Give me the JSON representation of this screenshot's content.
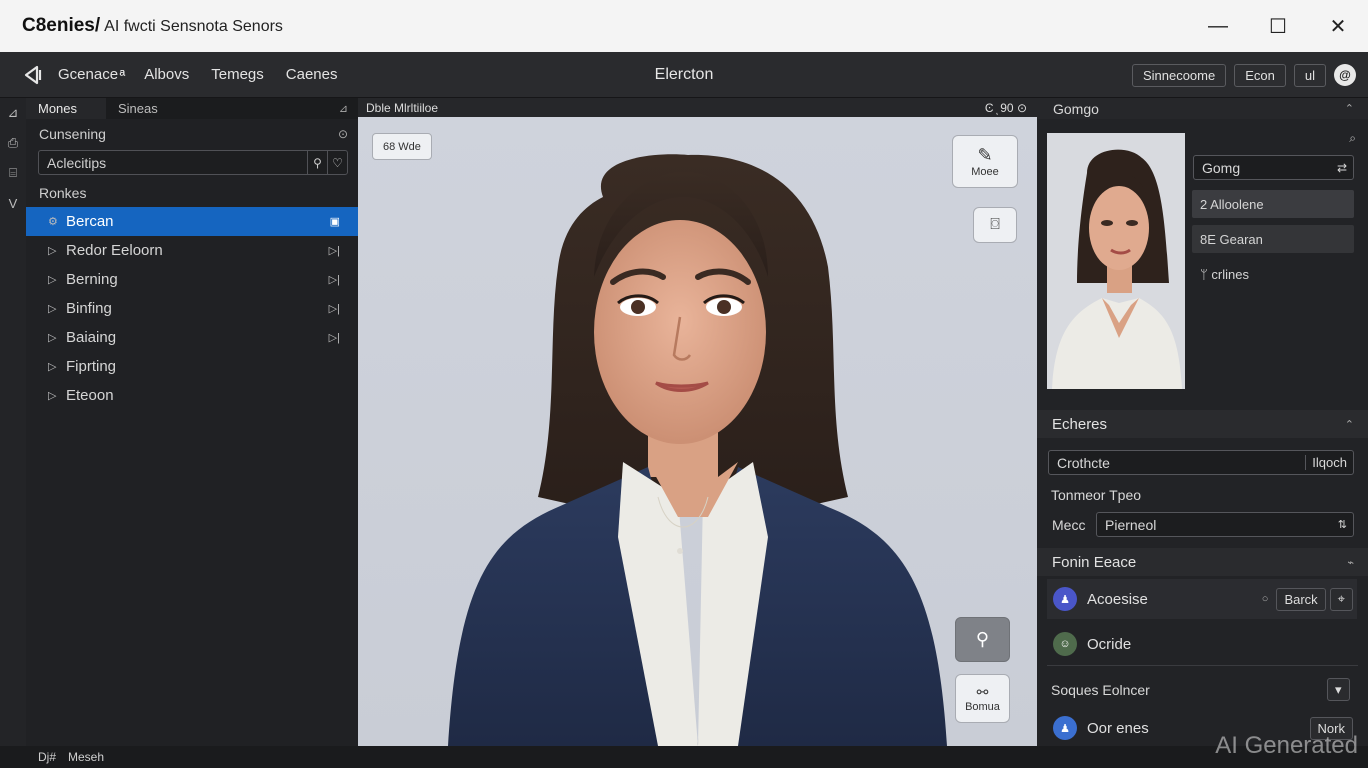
{
  "window": {
    "title_brand": "C8enies/",
    "title_rest": "AI fwcti Sensnota Senors",
    "minimize_glyph": "—",
    "maximize_glyph": "☐",
    "close_glyph": "✕"
  },
  "menubar": {
    "items": [
      "Gcenace ͣͣͣ",
      "Albovs",
      "Temegs",
      "Caenes"
    ],
    "center_title": "Elercton",
    "right_buttons": [
      "Sinnecoome",
      "Econ",
      "ul"
    ],
    "profile_glyph": "@"
  },
  "rail": {
    "icons": [
      "⊿",
      "⎙",
      "⌸",
      "V"
    ]
  },
  "left_panel": {
    "tabs": [
      "Mones",
      "Sineas"
    ],
    "section_title": "Cunsening",
    "search_value": "Aclecitips",
    "tree_header": "Ronkes",
    "tree_items": [
      {
        "label": "Bercan",
        "selected": true
      },
      {
        "label": "Redor Eeloorn",
        "selected": false
      },
      {
        "label": "Berning",
        "selected": false
      },
      {
        "label": "Binfing",
        "selected": false
      },
      {
        "label": "Baiaing",
        "selected": false
      },
      {
        "label": "Fiprting",
        "selected": false
      },
      {
        "label": "Eteoon",
        "selected": false
      }
    ]
  },
  "viewport": {
    "header_title": "Dble Mlrltiiloe",
    "header_right": "Ͼ ͅ 90 ⊙",
    "chip_label": "68 Wde",
    "tool_top": "Moee",
    "tool_bottom": "Bomua"
  },
  "right_panel": {
    "header": "Gomgo",
    "field_value": "Gomg",
    "options": [
      "2 Alloolene",
      "8E Gearan",
      "ᛘ crlines"
    ],
    "section2_title": "Echeres",
    "section2_field": "Crothcte",
    "section2_field_btn": "Ilqoch",
    "form_label": "Tonmeor Tpeo",
    "form_row_label": "Mecc",
    "form_row_value": "Pierneol",
    "section3_title": "Fonin Eeace",
    "list": [
      {
        "label": "Acoesise",
        "button": "Barck",
        "color": "#4a56c9"
      },
      {
        "label": "Ocride",
        "color": "#4f6b4c"
      }
    ],
    "section4_title": "Soques Eolncer",
    "last_item": "Oor enes",
    "last_item_btn": "Nork"
  },
  "statusbar": {
    "left": "Dj#",
    "text": "Meseh"
  },
  "watermark": "AI Generated"
}
